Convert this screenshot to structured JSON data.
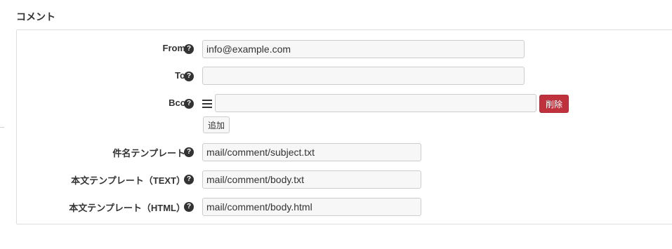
{
  "section": {
    "title": "コメント"
  },
  "fields": {
    "from": {
      "label": "From",
      "value": "info@example.com"
    },
    "to": {
      "label": "To",
      "value": ""
    },
    "bcc": {
      "label": "Bcc",
      "value": "",
      "delete_label": "削除",
      "add_label": "追加"
    },
    "subject_template": {
      "label": "件名テンプレート",
      "value": "mail/comment/subject.txt"
    },
    "body_text_template": {
      "label": "本文テンプレート（TEXT）",
      "value": "mail/comment/body.txt"
    },
    "body_html_template": {
      "label": "本文テンプレート（HTML）",
      "value": "mail/comment/body.html"
    }
  },
  "help_icon_glyph": "?",
  "colors": {
    "danger": "#c0313e",
    "panel_border": "#dddddd",
    "input_bg": "#f7f7f7"
  }
}
